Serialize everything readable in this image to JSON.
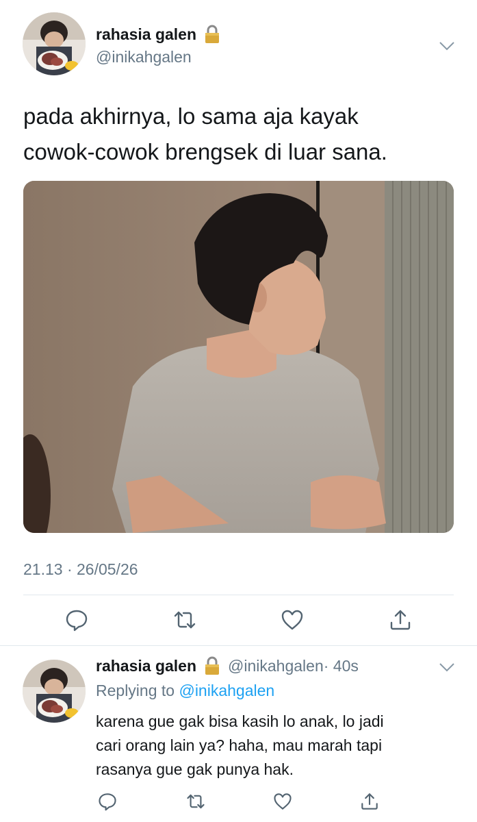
{
  "main_tweet": {
    "display_name": "rahasia galen",
    "handle": "@inikahgalen",
    "text_line1": "pada akhirnya, lo sama aja kayak",
    "text_line2": "cowok-cowok brengsek di luar sana.",
    "timestamp": "21.13 · 26/05/26",
    "icons": {
      "lock": "lock-icon",
      "menu": "chevron-down-icon",
      "reply": "reply-icon",
      "retweet": "retweet-icon",
      "like": "like-icon",
      "share": "share-icon"
    }
  },
  "reply_tweet": {
    "display_name": "rahasia galen",
    "handle": "@inikahgalen",
    "time": "· 40s",
    "replying_label": "Replying to",
    "replying_mention": "@inikahgalen",
    "text_line1": "karena gue gak bisa kasih lo anak, lo jadi",
    "text_line2": "cari orang lain ya? haha, mau marah tapi",
    "text_line3": "rasanya gue gak punya hak."
  },
  "colors": {
    "text_primary": "#14171a",
    "text_secondary": "#657786",
    "link_blue": "#1da1f2",
    "divider": "#e1e8ed"
  }
}
